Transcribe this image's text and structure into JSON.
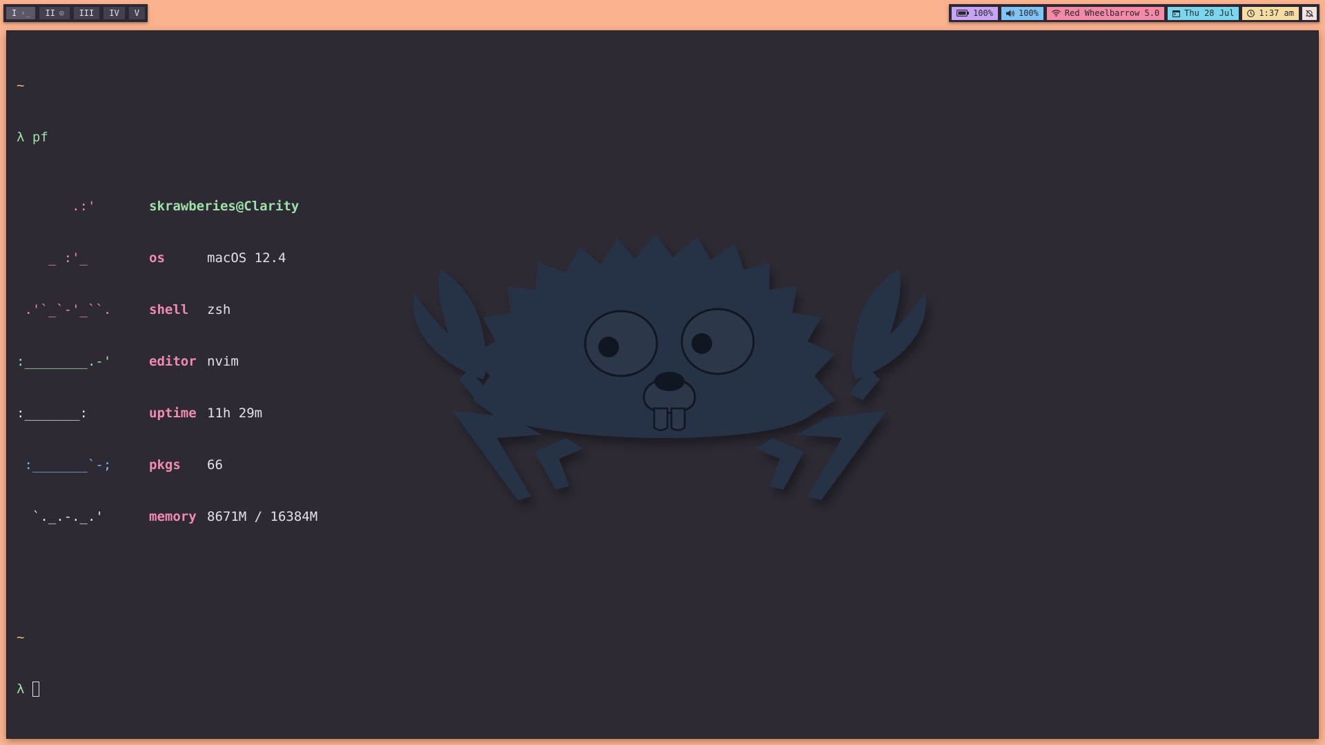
{
  "workspaces": [
    {
      "label": "I",
      "glyph": "›_",
      "active": true
    },
    {
      "label": "II",
      "glyph": "◎",
      "active": false
    },
    {
      "label": "III",
      "glyph": "",
      "active": false
    },
    {
      "label": "IV",
      "glyph": "",
      "active": false
    },
    {
      "label": "V",
      "glyph": "",
      "active": false
    }
  ],
  "status": {
    "battery": "100%",
    "volume": "100%",
    "wifi": "Red Wheelbarrow 5.0",
    "date": "Thu 28 Jul",
    "time": "1:37 am",
    "icons": [
      "battery-icon",
      "volume-icon",
      "wifi-icon",
      "calendar-icon",
      "clock-icon",
      "notification-off-icon"
    ]
  },
  "terminal": {
    "prompt_dir": "~",
    "prompt_symbol": "λ",
    "command": "pf",
    "art": [
      "       .:'",
      "    _ :'_",
      " .'`_`-'_``.",
      ":________.-'",
      ":_______:",
      " :_______`-;",
      "  `._.-._.'"
    ],
    "user_host": "skrawberies@Clarity",
    "info": [
      {
        "key": "os",
        "value": "macOS 12.4"
      },
      {
        "key": "shell",
        "value": "zsh"
      },
      {
        "key": "editor",
        "value": "nvim"
      },
      {
        "key": "uptime",
        "value": "11h 29m"
      },
      {
        "key": "pkgs",
        "value": "66"
      },
      {
        "key": "memory",
        "value": "8671M / 16384M"
      }
    ]
  },
  "colors": {
    "desktop": "#f9b28e",
    "terminal_bg": "#2d2a34",
    "accent_pink": "#f28bb0",
    "accent_green": "#9fe0a8",
    "accent_blue": "#7fb8f2",
    "mascot": "#263244"
  }
}
